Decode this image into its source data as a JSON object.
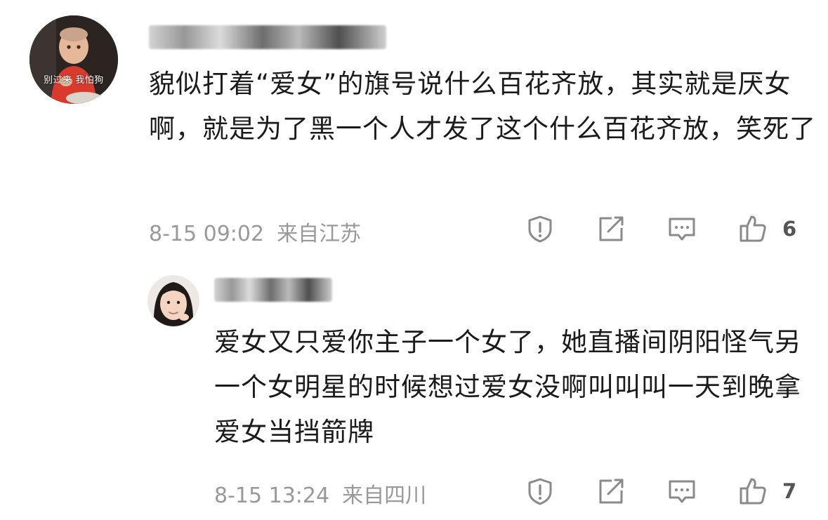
{
  "comments": [
    {
      "avatar_caption": "别过来  我怕狗",
      "text": "貌似打着“爱女”的旗号说什么百花齐放，其实就是厌女啊，就是为了黑一个人才发了这个什么百花齐放，笑死了",
      "date": "8-15 09:02",
      "location": "来自江苏",
      "like_count": "6"
    },
    {
      "text": "爱女又只爱你主子一个女了，她直播间阴阳怪气另一个女明星的时候想过爱女没啊叫叫叫一天到晚拿爱女当挡箭牌",
      "date": "8-15 13:24",
      "location": "来自四川",
      "like_count": "7"
    }
  ],
  "icons": {
    "report": "report-icon",
    "repost": "repost-icon",
    "comment": "comment-icon",
    "like": "thumbs-up-icon"
  },
  "colors": {
    "text": "#1b1b1b",
    "meta": "#999999",
    "icon": "#8a8a8a",
    "background": "#ffffff"
  }
}
